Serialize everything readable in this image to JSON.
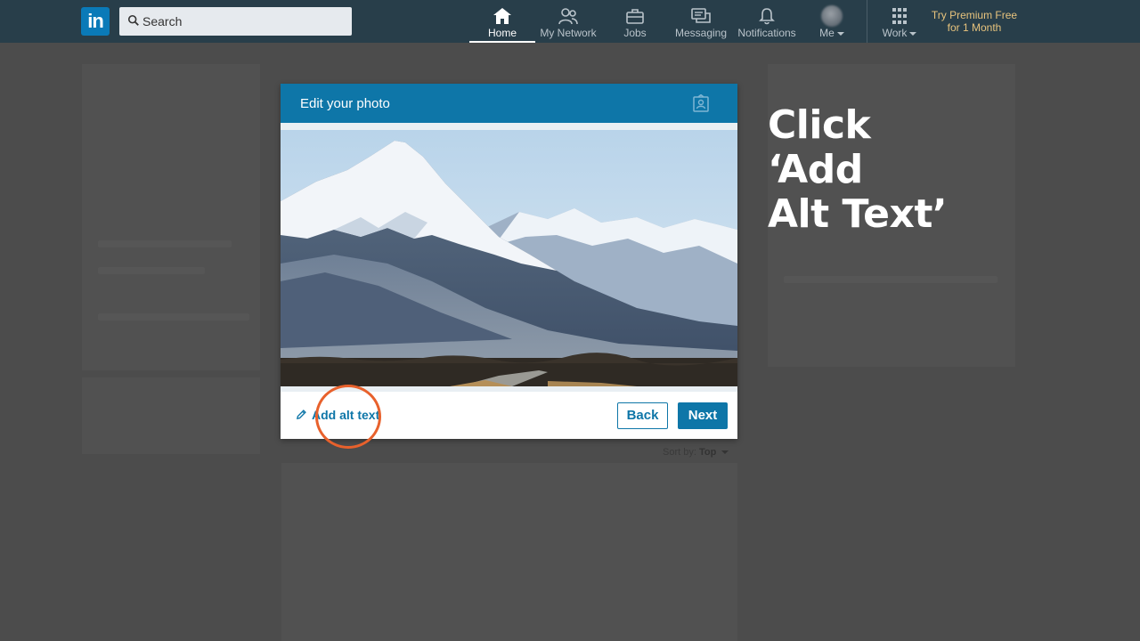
{
  "nav": {
    "search_placeholder": "Search",
    "items": [
      {
        "label": "Home",
        "icon": "home-icon",
        "active": true
      },
      {
        "label": "My Network",
        "icon": "network-icon"
      },
      {
        "label": "Jobs",
        "icon": "briefcase-icon"
      },
      {
        "label": "Messaging",
        "icon": "messaging-icon"
      },
      {
        "label": "Notifications",
        "icon": "bell-icon"
      },
      {
        "label": "Me",
        "icon": "avatar"
      },
      {
        "label": "Work",
        "icon": "grid-icon"
      }
    ],
    "premium_line1": "Try Premium Free",
    "premium_line2": "for 1 Month"
  },
  "background": {
    "sort_label": "Sort by:",
    "sort_value": "Top"
  },
  "modal": {
    "title": "Edit your photo",
    "add_alt_text": "Add alt text",
    "back_label": "Back",
    "next_label": "Next"
  },
  "callout": {
    "line1": "Click",
    "line2": "‘Add",
    "line3": "Alt Text’"
  },
  "colors": {
    "nav_bg": "#283e4a",
    "brand_blue": "#0e76a8",
    "premium_gold": "#e7c37d",
    "highlight_orange": "#e8612c",
    "overlay_gray": "#4c4c4c"
  }
}
